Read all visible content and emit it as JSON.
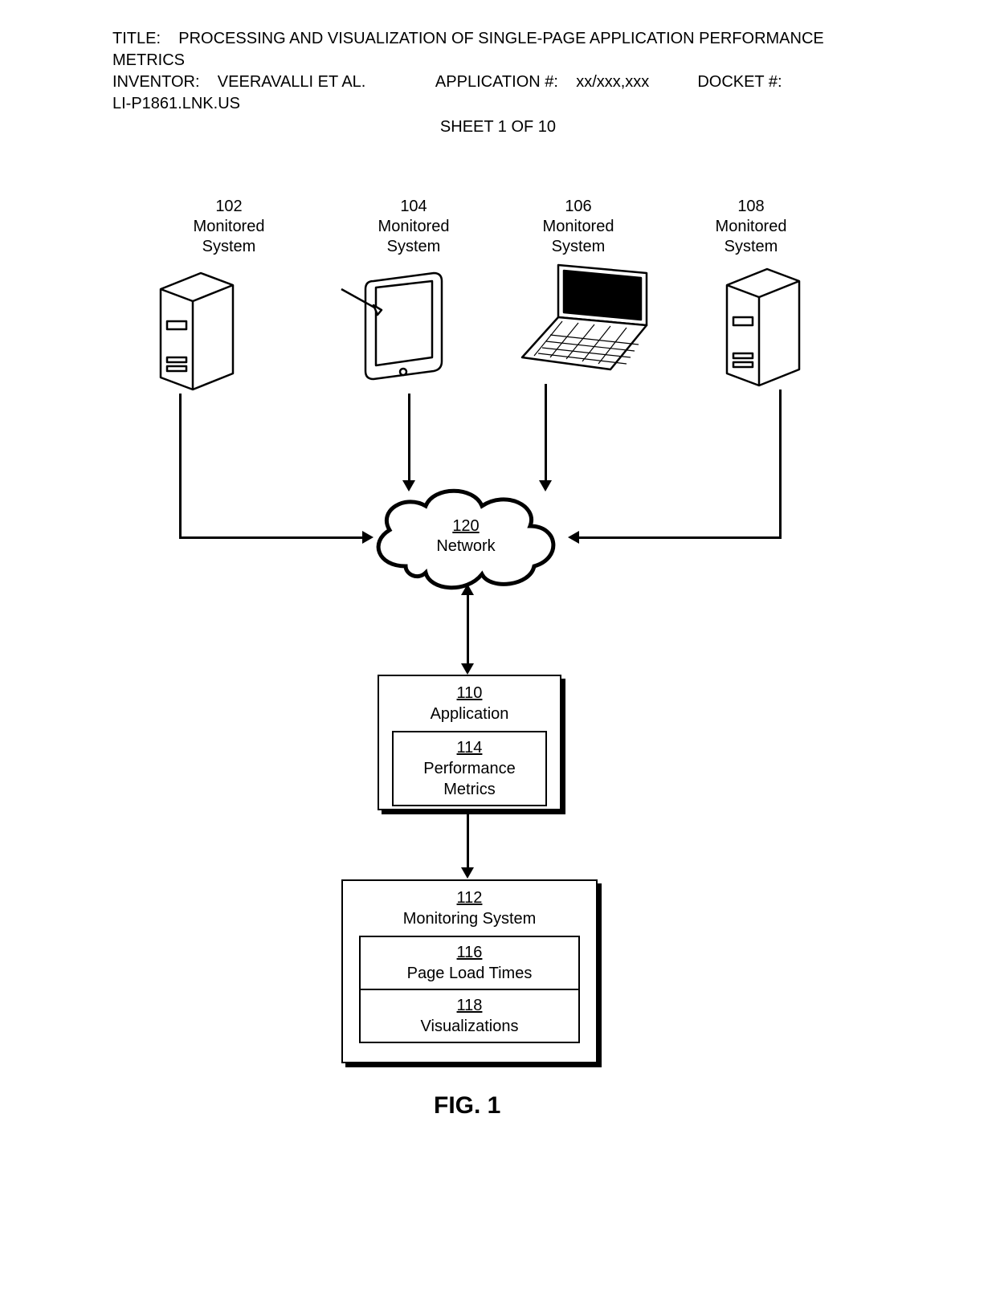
{
  "header": {
    "title_label": "TITLE:",
    "title_text": "PROCESSING AND VISUALIZATION OF SINGLE-PAGE APPLICATION PERFORMANCE METRICS",
    "inventor_label": "INVENTOR:",
    "inventor_text": "VEERAVALLI ET AL.",
    "app_label": "APPLICATION #:",
    "app_text": "xx/xxx,xxx",
    "docket_label": "DOCKET #:",
    "docket_text": "LI-P1861.LNK.US",
    "sheet_text": "SHEET 1 OF 10"
  },
  "nodes": {
    "n102": {
      "num": "102",
      "label": "Monitored System"
    },
    "n104": {
      "num": "104",
      "label": "Monitored System"
    },
    "n106": {
      "num": "106",
      "label": "Monitored System"
    },
    "n108": {
      "num": "108",
      "label": "Monitored System"
    },
    "n120": {
      "num": "120",
      "label": "Network"
    },
    "n110": {
      "num": "110",
      "label": "Application"
    },
    "n114": {
      "num": "114",
      "label": "Performance Metrics"
    },
    "n112": {
      "num": "112",
      "label": "Monitoring System"
    },
    "n116": {
      "num": "116",
      "label": "Page Load Times"
    },
    "n118": {
      "num": "118",
      "label": "Visualizations"
    }
  },
  "figure_caption": "FIG. 1"
}
